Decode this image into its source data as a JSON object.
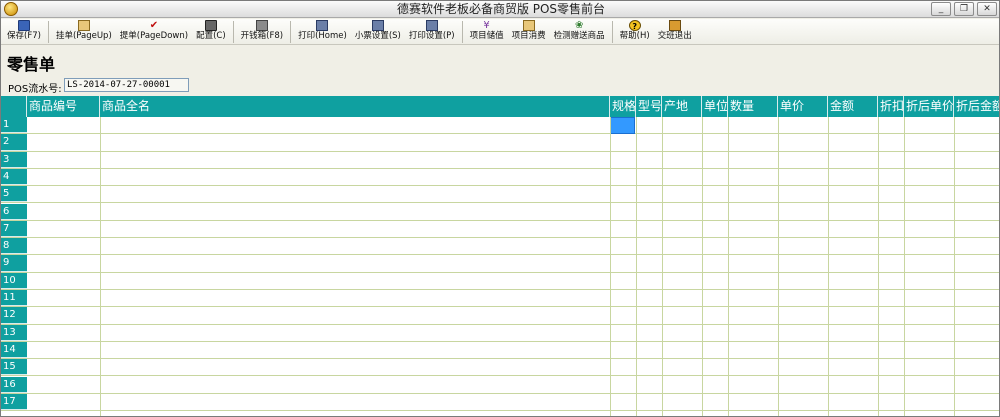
{
  "window": {
    "title": "德赛软件老板必备商贸版 POS零售前台",
    "controls": [
      "_",
      "❐",
      "✕"
    ]
  },
  "toolbar": [
    {
      "label": "保存(F7)",
      "icon": "floppy-icon"
    },
    {
      "sep": true
    },
    {
      "label": "挂单(PageUp)",
      "icon": "hold-icon"
    },
    {
      "label": "提单(PageDown)",
      "icon": "check-icon"
    },
    {
      "label": "配置(C)",
      "icon": "config-icon"
    },
    {
      "sep": true
    },
    {
      "label": "开钱箱(F8)",
      "icon": "drawer-icon"
    },
    {
      "sep": true
    },
    {
      "label": "打印(Home)",
      "icon": "print-icon"
    },
    {
      "label": "小票设置(S)",
      "icon": "receipt-icon"
    },
    {
      "label": "打印设置(P)",
      "icon": "print-settings-icon"
    },
    {
      "sep": true
    },
    {
      "label": "项目储值",
      "icon": "coin-icon"
    },
    {
      "label": "项目消费",
      "icon": "consume-icon"
    },
    {
      "label": "检测赠送商品",
      "icon": "gift-icon"
    },
    {
      "sep": true
    },
    {
      "label": "帮助(H)",
      "icon": "help-icon"
    },
    {
      "label": "交班退出",
      "icon": "exit-icon"
    }
  ],
  "form": {
    "title": "零售单",
    "serial_label": "POS流水号:",
    "serial_value": "LS-2014-07-27-00001"
  },
  "grid": {
    "columns": [
      "商品编号",
      "商品全名",
      "规格",
      "型号",
      "产地",
      "单位",
      "数量",
      "单价",
      "金额",
      "折扣",
      "折后单价",
      "折后金额"
    ],
    "rows": [
      "1",
      "2",
      "3",
      "4",
      "5",
      "6",
      "7",
      "8",
      "9",
      "10",
      "11",
      "12",
      "13",
      "14",
      "15",
      "16",
      "17"
    ]
  },
  "colors": {
    "header": "#0fa0a0",
    "selection": "#3399ff"
  }
}
